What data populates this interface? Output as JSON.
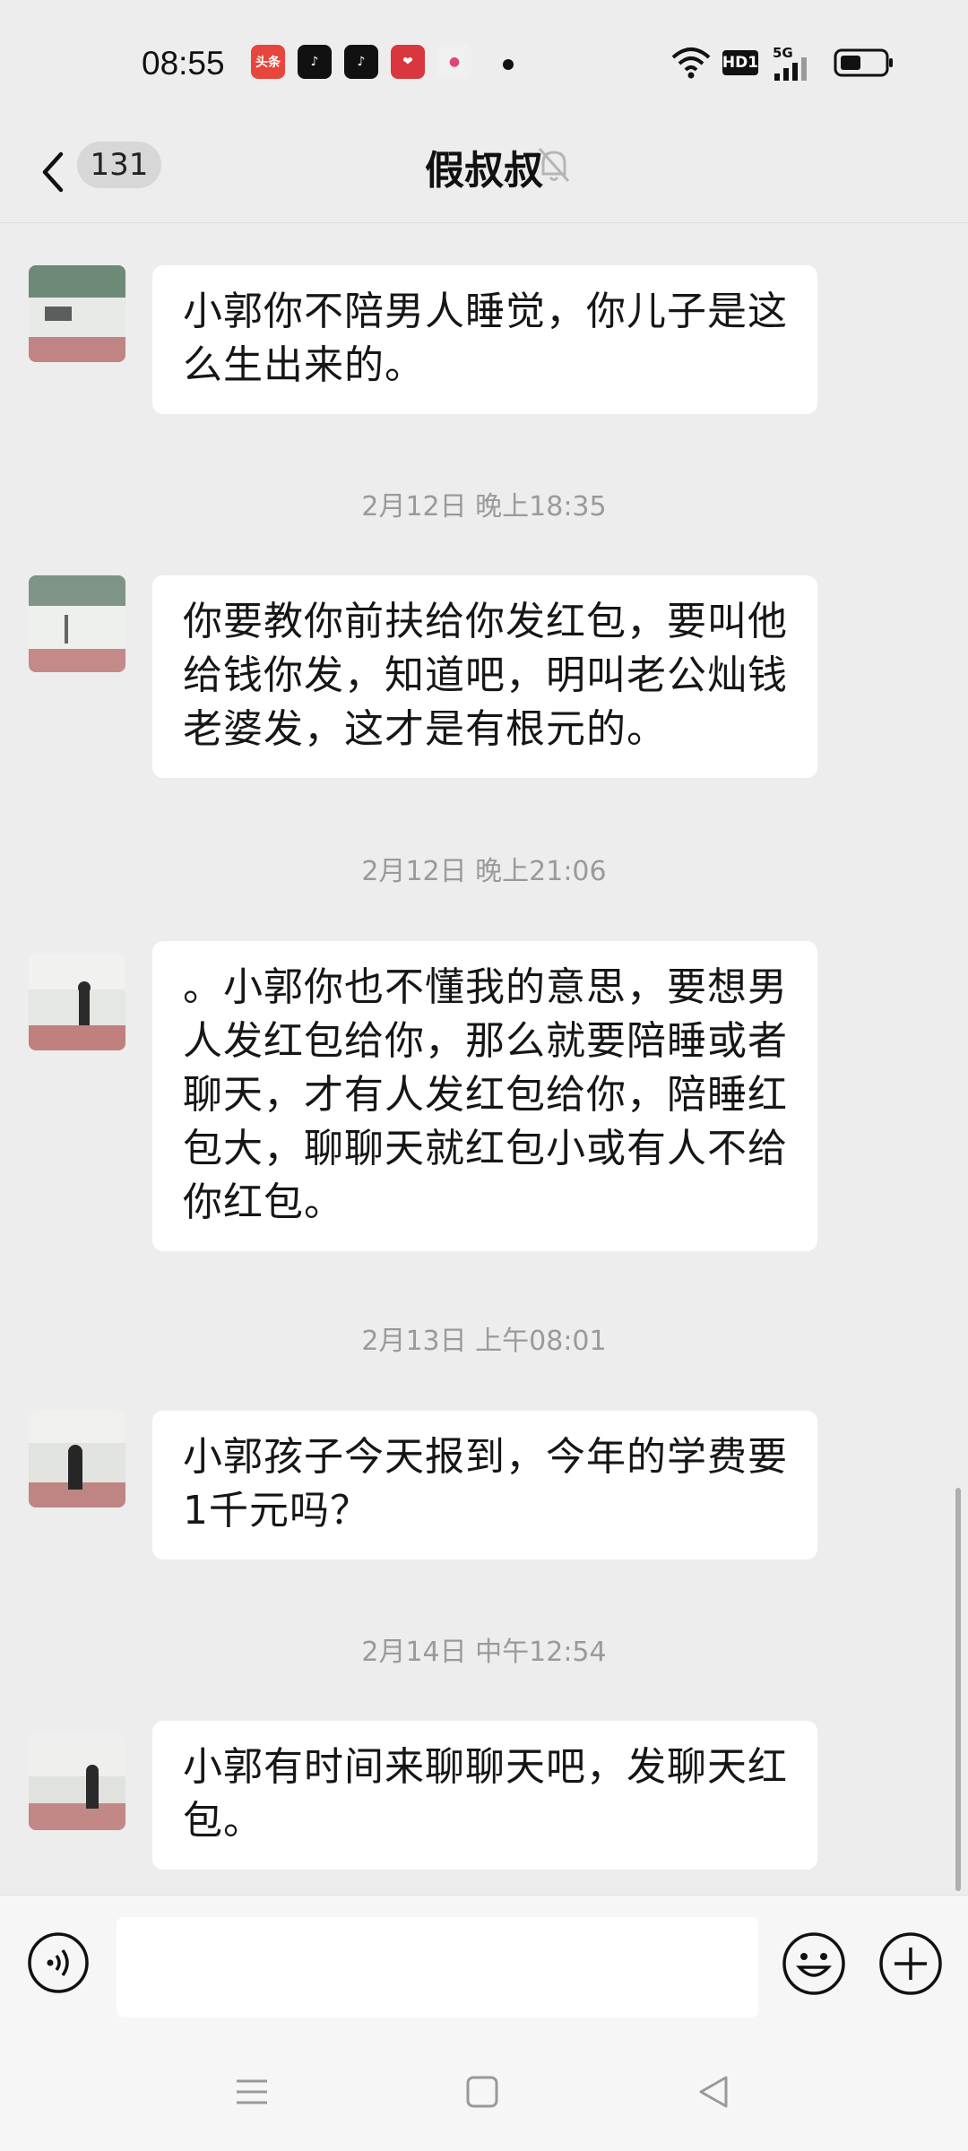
{
  "status_bar": {
    "time": "08:55",
    "apps": [
      "头条",
      "抖音",
      "抖音",
      "爱心",
      "相机"
    ],
    "hd_label": "HD1",
    "net_label": "5G"
  },
  "header": {
    "back_count": "131",
    "title": "假叔叔"
  },
  "messages": [
    {
      "type": "text",
      "text": "小郭你不陪男人睡觉，你儿子是这么生出来的。"
    },
    {
      "type": "time",
      "text": "2月12日 晚上18:35"
    },
    {
      "type": "text",
      "text": "你要教你前扶给你发红包，要叫他给钱你发，知道吧，明叫老公灿钱老婆发，这才是有根元的。"
    },
    {
      "type": "time",
      "text": "2月12日 晚上21:06"
    },
    {
      "type": "text",
      "text": "。小郭你也不懂我的意思，要想男人发红包给你，那么就要陪睡或者聊天，才有人发红包给你，陪睡红包大，聊聊天就红包小或有人不给你红包。"
    },
    {
      "type": "time",
      "text": "2月13日 上午08:01"
    },
    {
      "type": "text",
      "text": "小郭孩子今天报到，今年的学费要1千元吗？"
    },
    {
      "type": "time",
      "text": "2月14日 中午12:54"
    },
    {
      "type": "text",
      "text": "小郭有时间来聊聊天吧，发聊天红包。"
    }
  ],
  "input": {
    "value": "",
    "icons": [
      "voice-icon",
      "emoji-icon",
      "plus-icon"
    ]
  },
  "colors": {
    "background": "#ededed",
    "bubble": "#ffffff",
    "timestamp": "#9a9a9a"
  }
}
